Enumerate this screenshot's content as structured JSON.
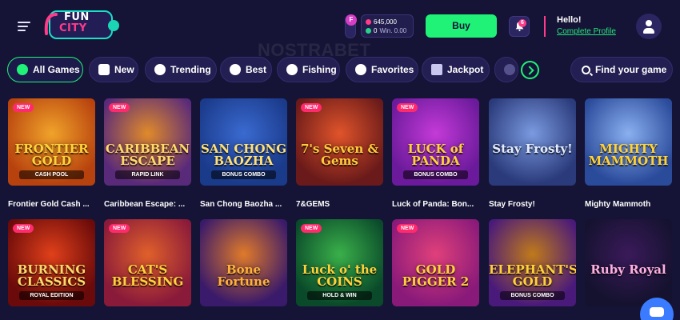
{
  "header": {
    "menu_icon": "hamburger-icon",
    "logo_text_top": "FUN",
    "logo_text_bottom": "CITY",
    "watermark": "NOSTRABET",
    "level_badge": "F",
    "wallet": {
      "gc_amount": "645,000",
      "sc_amount": "0",
      "win_label": "Win. 0.00"
    },
    "buy_label": "Buy",
    "notification_count": "6",
    "greeting": "Hello!",
    "complete_profile": "Complete Profile"
  },
  "categories": [
    {
      "label": "All Games",
      "icon": "cherries-icon",
      "active": true
    },
    {
      "label": "New",
      "icon": "new-icon"
    },
    {
      "label": "Trending",
      "icon": "timer-icon"
    },
    {
      "label": "Best",
      "icon": "flame-icon"
    },
    {
      "label": "Fishing",
      "icon": "fish-icon"
    },
    {
      "label": "Favorites",
      "icon": "heart-icon"
    },
    {
      "label": "Jackpot",
      "icon": "jackpot-icon"
    }
  ],
  "search_label": "Find your game",
  "new_badge": "NEW",
  "games_row1": [
    {
      "name": "Frontier Gold Cash ...",
      "art_title": "FRONTIER GOLD",
      "art_sub": "CASH POOL",
      "new": true,
      "bg": "#b8420e",
      "bg2": "#f0a32a",
      "title_color": "#ffd23a"
    },
    {
      "name": "Caribbean Escape: ...",
      "art_title": "CARIBBEAN ESCAPE",
      "art_sub": "RAPID LINK",
      "new": true,
      "bg": "#5a2a7a",
      "bg2": "#e08a2a",
      "title_color": "#ffd96a"
    },
    {
      "name": "San Chong Baozha ...",
      "art_title": "SAN CHONG BAOZHA",
      "art_sub": "BONUS COMBO",
      "new": false,
      "bg": "#1a3a8a",
      "bg2": "#3a6ad0",
      "title_color": "#ffe07a"
    },
    {
      "name": "7&GEMS",
      "art_title": "7's Seven & Gems",
      "art_sub": "",
      "new": true,
      "bg": "#6a1a1a",
      "bg2": "#e0542a",
      "title_color": "#ffcb3a"
    },
    {
      "name": "Luck of Panda: Bon...",
      "art_title": "LUCK of PANDA",
      "art_sub": "BONUS COMBO",
      "new": true,
      "bg": "#6a1a9a",
      "bg2": "#c43ad8",
      "title_color": "#ffd23a"
    },
    {
      "name": "Stay Frosty!",
      "art_title": "Stay Frosty!",
      "art_sub": "",
      "new": false,
      "bg": "#2a3a7a",
      "bg2": "#7a9ae0",
      "title_color": "#e4ecff"
    },
    {
      "name": "Mighty Mammoth",
      "art_title": "MIGHTY MAMMOTH",
      "art_sub": "",
      "new": false,
      "bg": "#2a4a9a",
      "bg2": "#8ab0f0",
      "title_color": "#ffd23a"
    }
  ],
  "games_row2": [
    {
      "art_title": "BURNING CLASSICS",
      "art_sub": "ROYAL EDITION",
      "new": true,
      "bg": "#6a0a0a",
      "bg2": "#e0401a",
      "title_color": "#ffd96a"
    },
    {
      "art_title": "CAT'S BLESSING",
      "art_sub": "",
      "new": true,
      "bg": "#8a1a3a",
      "bg2": "#e0602a",
      "title_color": "#ffd23a"
    },
    {
      "art_title": "Bone Fortune",
      "art_sub": "",
      "new": false,
      "bg": "#3a1a6a",
      "bg2": "#e07a2a",
      "title_color": "#ffb23a"
    },
    {
      "art_title": "Luck o' the COINS",
      "art_sub": "HOLD & WIN",
      "new": true,
      "bg": "#0a4a2a",
      "bg2": "#3ab04a",
      "title_color": "#ffd23a"
    },
    {
      "art_title": "GOLD PIGGER 2",
      "art_sub": "",
      "new": true,
      "bg": "#8a1a7a",
      "bg2": "#e0407a",
      "title_color": "#ffd23a"
    },
    {
      "art_title": "ELEPHANT'S GOLD",
      "art_sub": "BONUS COMBO",
      "new": false,
      "bg": "#4a1a7a",
      "bg2": "#c07a1a",
      "title_color": "#ffd23a"
    },
    {
      "art_title": "Ruby Royal",
      "art_sub": "",
      "new": false,
      "bg": "#14122e",
      "bg2": "#3a1a5a",
      "title_color": "#ffb0e0"
    }
  ]
}
